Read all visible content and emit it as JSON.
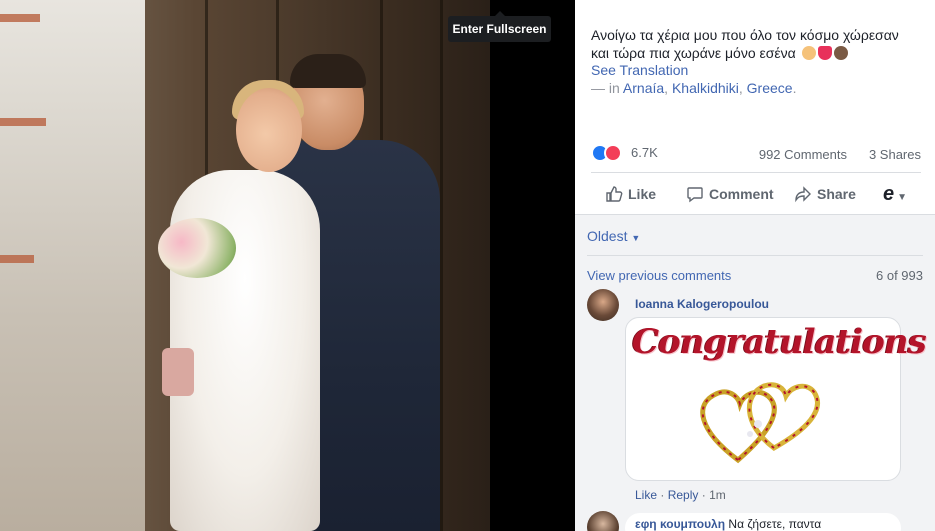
{
  "tooltip": {
    "label": "Enter Fullscreen"
  },
  "post": {
    "text_line1": "Ανοίγω τα χέρια μου που όλο τον κόσμο χώρεσαν",
    "text_line2": "και τώρα πια χωράνε μόνο εσένα",
    "see_translation": "See Translation",
    "location_prefix": "— in",
    "location_town": "Arnaía",
    "location_sep": ",",
    "location_region": "Khalkidhiki",
    "location_country": "Greece",
    "location_end": "."
  },
  "stats": {
    "reactions": "6.7K",
    "comments": "992 Comments",
    "shares": "3 Shares"
  },
  "actions": {
    "like": "Like",
    "comment": "Comment",
    "share": "Share",
    "e_icon": "e"
  },
  "comments": {
    "sort": "Oldest",
    "view_previous": "View previous comments",
    "count": "6 of 993",
    "first": {
      "name": "Ioanna Kalogeropoulou",
      "sticker_text": "Congratulations",
      "like": "Like",
      "dot": "·",
      "reply": "Reply",
      "time": "1m"
    },
    "second": {
      "name": "εφη κουμπουλη",
      "text": "Να ζήσετε, παντα"
    }
  },
  "colors": {
    "facebook_blue": "#4267b2",
    "like_blue": "#2078f4",
    "love_red": "#f33e58"
  }
}
